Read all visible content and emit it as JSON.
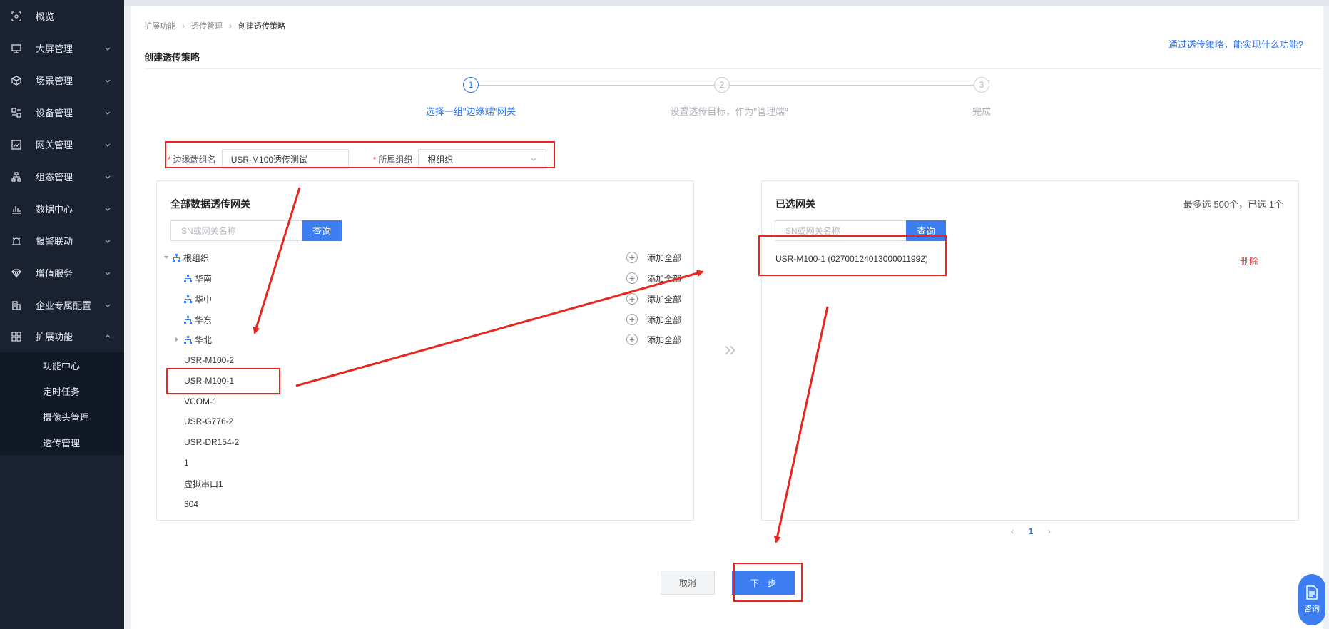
{
  "sidebar": {
    "items": [
      {
        "label": "概览",
        "icon": "overview-icon",
        "has_arrow": false
      },
      {
        "label": "大屏管理",
        "icon": "screen-icon",
        "has_arrow": true
      },
      {
        "label": "场景管理",
        "icon": "cube-icon",
        "has_arrow": true
      },
      {
        "label": "设备管理",
        "icon": "device-icon",
        "has_arrow": true
      },
      {
        "label": "网关管理",
        "icon": "chart-line-icon",
        "has_arrow": true
      },
      {
        "label": "组态管理",
        "icon": "network-icon",
        "has_arrow": true
      },
      {
        "label": "数据中心",
        "icon": "bar-chart-icon",
        "has_arrow": true
      },
      {
        "label": "报警联动",
        "icon": "alarm-icon",
        "has_arrow": true
      },
      {
        "label": "增值服务",
        "icon": "diamond-icon",
        "has_arrow": true
      },
      {
        "label": "企业专属配置",
        "icon": "building-icon",
        "has_arrow": true
      },
      {
        "label": "扩展功能",
        "icon": "grid-icon",
        "has_arrow": true,
        "expanded": true
      }
    ],
    "sub_items": [
      "功能中心",
      "定时任务",
      "摄像头管理",
      "透传管理"
    ]
  },
  "breadcrumb": [
    "扩展功能",
    "透传管理",
    "创建透传策略"
  ],
  "page_title": "创建透传策略",
  "help_link": "通过透传策略，能实现什么功能?",
  "steps": [
    {
      "num": "1",
      "label": "选择一组\"边缘端\"网关",
      "active": true
    },
    {
      "num": "2",
      "label": "设置透传目标，作为\"管理端\"",
      "active": false
    },
    {
      "num": "3",
      "label": "完成",
      "active": false
    }
  ],
  "form": {
    "group_name_label": "边缘端组名",
    "group_name_value": "USR-M100透传测试",
    "org_label": "所属组织",
    "org_value": "根组织"
  },
  "left_panel": {
    "title": "全部数据透传网关",
    "search_placeholder": "SN或网关名称",
    "search_button": "查询",
    "add_all_label": "添加全部",
    "root": "根组织",
    "orgs": [
      "华南",
      "华中",
      "华东",
      "华北"
    ],
    "gateways": [
      "USR-M100-2",
      "USR-M100-1",
      "VCOM-1",
      "USR-G776-2",
      "USR-DR154-2",
      "1",
      "虚拟串口1",
      "304"
    ]
  },
  "right_panel": {
    "title": "已选网关",
    "limit_text": "最多选 500个，已选 1个",
    "search_placeholder": "SN或网关名称",
    "search_button": "查询",
    "selected": "USR-M100-1  (02700124013000011992)",
    "delete_label": "删除"
  },
  "pagination": {
    "prev": "‹",
    "current": "1",
    "next": "›"
  },
  "buttons": {
    "cancel": "取消",
    "next": "下一步"
  },
  "consult_label": "咨询",
  "colors": {
    "accent": "#3c7ef2",
    "annotation": "#e8251f",
    "sidebar": "#1a2232"
  }
}
